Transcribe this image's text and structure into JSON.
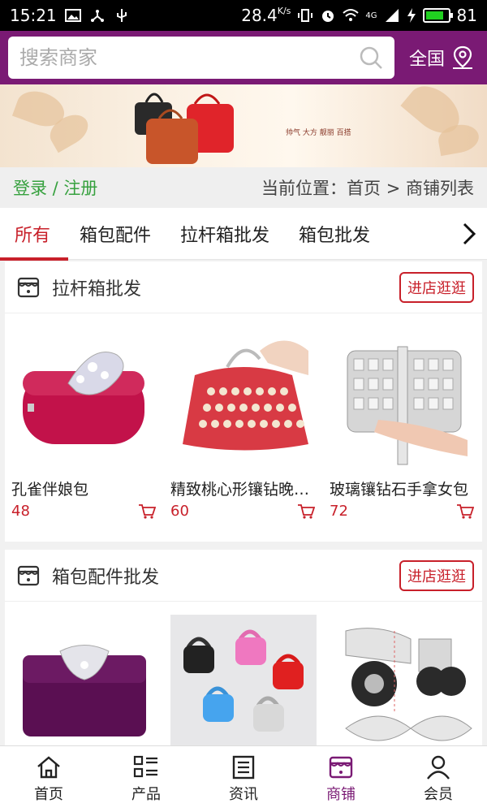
{
  "status_bar": {
    "time": "15:21",
    "speed": "28.4",
    "speed_unit": "K/s",
    "network": "4G",
    "battery_level": "81",
    "battery_fraction": 0.81
  },
  "search": {
    "placeholder": "搜索商家",
    "region_label": "全国"
  },
  "banner": {
    "slogan": "帅气 大方 靓丽 百搭"
  },
  "breadcrumb": {
    "login_label": "登录 / 注册",
    "location_prefix": "当前位置：",
    "path": "首页 > 商铺列表"
  },
  "tabs": [
    {
      "label": "所有",
      "active": true
    },
    {
      "label": "箱包配件",
      "active": false
    },
    {
      "label": "拉杆箱批发",
      "active": false
    },
    {
      "label": "箱包批发",
      "active": false
    }
  ],
  "shops": [
    {
      "name": "拉杆箱批发",
      "enter_label": "进店逛逛",
      "products": [
        {
          "name": "孔雀伴娘包",
          "price": "48"
        },
        {
          "name": "精致桃心形镶钻晚宴包",
          "price": "60"
        },
        {
          "name": "玻璃镶钻石手拿女包",
          "price": "72"
        }
      ]
    },
    {
      "name": "箱包配件批发",
      "enter_label": "进店逛逛",
      "products": [
        {
          "name": "",
          "price": ""
        },
        {
          "name": "",
          "price": ""
        },
        {
          "name": "",
          "price": ""
        }
      ]
    }
  ],
  "bottom_nav": [
    {
      "label": "首页",
      "icon": "home-icon"
    },
    {
      "label": "产品",
      "icon": "list-icon"
    },
    {
      "label": "资讯",
      "icon": "news-icon"
    },
    {
      "label": "商铺",
      "icon": "shop-icon",
      "active": true
    },
    {
      "label": "会员",
      "icon": "user-icon"
    }
  ],
  "colors": {
    "brand": "#7a1a74",
    "accent": "#c8202a",
    "login_green": "#37a13f"
  }
}
